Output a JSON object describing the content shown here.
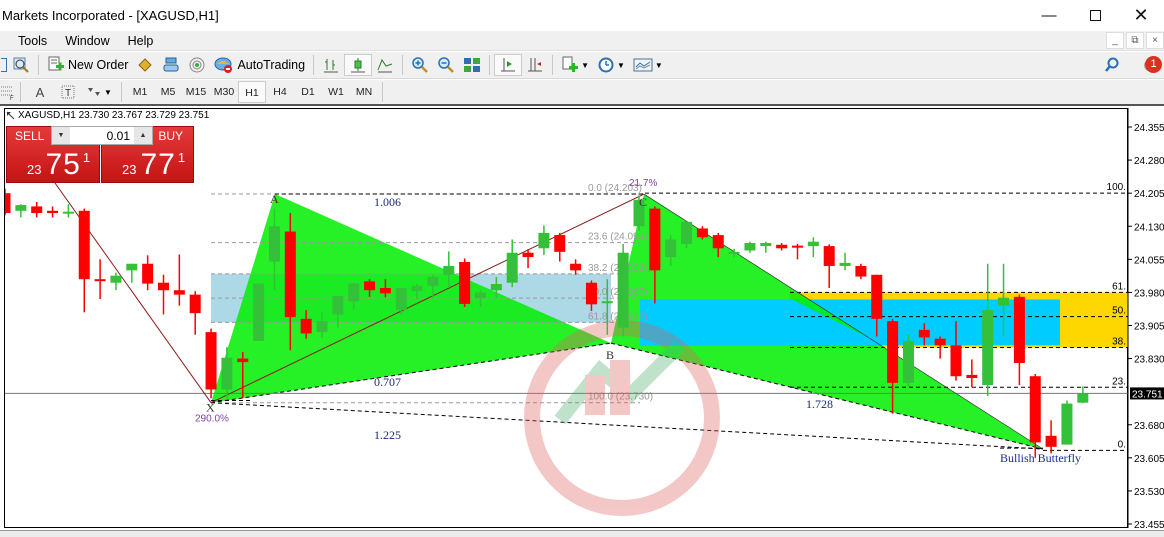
{
  "window": {
    "title": "Markets Incorporated - [XAGUSD,H1]",
    "controls": [
      "minimize",
      "maximize",
      "close"
    ]
  },
  "menu": {
    "items": [
      "Tools",
      "Window",
      "Help"
    ]
  },
  "toolbar": {
    "new_order_label": "New Order",
    "autotrading_label": "AutoTrading",
    "notification_count": "1"
  },
  "timeframes": {
    "items": [
      "M1",
      "M5",
      "M15",
      "M30",
      "H1",
      "H4",
      "D1",
      "W1",
      "MN"
    ],
    "active": "H1"
  },
  "chart": {
    "symbol_info": "XAGUSD,H1  23.730 23.767 23.729 23.751",
    "symbol": "XAGUSD",
    "timeframe": "H1",
    "ohlc": {
      "open": "23.730",
      "high": "23.767",
      "low": "23.729",
      "close": "23.751"
    },
    "current_price": "23.751",
    "price_axis": [
      "24.355",
      "24.280",
      "24.205",
      "24.130",
      "24.055",
      "23.980",
      "23.905",
      "23.830",
      "23.751",
      "23.680",
      "23.605",
      "23.530",
      "23.455"
    ]
  },
  "one_click_trading": {
    "sell_label": "SELL",
    "buy_label": "BUY",
    "lot": "0.01",
    "sell_price": {
      "prefix": "23",
      "main": "75",
      "sup": "1"
    },
    "buy_price": {
      "prefix": "23",
      "main": "77",
      "sup": "1"
    }
  },
  "pattern": {
    "name": "Bullish Butterfly",
    "points": {
      "X": "X",
      "A": "A",
      "B": "B",
      "C": "C",
      "D": ""
    },
    "ratios": {
      "XA_AB": "1.006",
      "AB": "0.707",
      "XD": "1.225",
      "BC_CD": "1.728"
    },
    "x_label": "290.0%",
    "c_label": "21.7%"
  },
  "fib_retracement": {
    "levels": [
      "0.0 (24.203)",
      "23.6 (24.093)",
      "38.2 (24.022)",
      "50.0 (23.967)",
      "61.8 (23.912)",
      "100.0 (23.730)"
    ]
  },
  "fib_right": {
    "levels": [
      "100.",
      "61.",
      "50.",
      "38.",
      "23.",
      "0."
    ]
  },
  "colors": {
    "bull": "#35c03a",
    "bear": "#ff0000",
    "pattern_fill": "#00ee00",
    "zone_blue": "#00ccff",
    "zone_lightblue": "#add8e6",
    "zone_yellow": "#ffd700",
    "sell_bg": "#d42020",
    "price_tag_bg": "#000000"
  },
  "candles": [
    {
      "o": 24.205,
      "h": 24.215,
      "l": 24.155,
      "c": 24.16
    },
    {
      "o": 24.165,
      "h": 24.18,
      "l": 24.15,
      "c": 24.178
    },
    {
      "o": 24.175,
      "h": 24.185,
      "l": 24.15,
      "c": 24.16
    },
    {
      "o": 24.165,
      "h": 24.175,
      "l": 24.15,
      "c": 24.16
    },
    {
      "o": 24.16,
      "h": 24.18,
      "l": 24.15,
      "c": 24.163
    },
    {
      "o": 24.165,
      "h": 24.17,
      "l": 23.935,
      "c": 24.01
    },
    {
      "o": 24.01,
      "h": 24.055,
      "l": 23.965,
      "c": 24.008
    },
    {
      "o": 24.002,
      "h": 24.025,
      "l": 23.985,
      "c": 24.018
    },
    {
      "o": 24.03,
      "h": 24.045,
      "l": 24.002,
      "c": 24.045
    },
    {
      "o": 24.045,
      "h": 24.064,
      "l": 23.985,
      "c": 24.0
    },
    {
      "o": 24.002,
      "h": 24.02,
      "l": 23.93,
      "c": 23.985
    },
    {
      "o": 23.985,
      "h": 24.066,
      "l": 23.95,
      "c": 23.975
    },
    {
      "o": 23.975,
      "h": 23.983,
      "l": 23.884,
      "c": 23.933
    },
    {
      "o": 23.89,
      "h": 23.898,
      "l": 23.74,
      "c": 23.76
    },
    {
      "o": 23.76,
      "h": 23.856,
      "l": 23.74,
      "c": 23.832
    },
    {
      "o": 23.83,
      "h": 23.845,
      "l": 23.74,
      "c": 23.822
    },
    {
      "o": 23.87,
      "h": 24.0,
      "l": 23.87,
      "c": 24.0
    },
    {
      "o": 24.05,
      "h": 24.17,
      "l": 23.985,
      "c": 24.13
    },
    {
      "o": 24.118,
      "h": 24.16,
      "l": 23.849,
      "c": 23.924
    },
    {
      "o": 23.92,
      "h": 23.94,
      "l": 23.875,
      "c": 23.887
    },
    {
      "o": 23.89,
      "h": 23.935,
      "l": 23.878,
      "c": 23.915
    },
    {
      "o": 23.93,
      "h": 23.96,
      "l": 23.9,
      "c": 23.972
    },
    {
      "o": 23.96,
      "h": 24.002,
      "l": 23.94,
      "c": 24.0
    },
    {
      "o": 24.005,
      "h": 24.01,
      "l": 23.97,
      "c": 23.985
    },
    {
      "o": 23.99,
      "h": 24.01,
      "l": 23.969,
      "c": 23.978
    },
    {
      "o": 23.94,
      "h": 23.99,
      "l": 23.93,
      "c": 23.99
    },
    {
      "o": 23.983,
      "h": 24.0,
      "l": 23.965,
      "c": 23.995
    },
    {
      "o": 23.995,
      "h": 24.02,
      "l": 23.968,
      "c": 24.015
    },
    {
      "o": 24.02,
      "h": 24.073,
      "l": 23.99,
      "c": 24.04
    },
    {
      "o": 24.049,
      "h": 24.057,
      "l": 23.947,
      "c": 23.954
    },
    {
      "o": 23.967,
      "h": 23.985,
      "l": 23.947,
      "c": 23.98
    },
    {
      "o": 23.985,
      "h": 24.015,
      "l": 23.968,
      "c": 23.999
    },
    {
      "o": 24.002,
      "h": 24.1,
      "l": 23.992,
      "c": 24.07
    },
    {
      "o": 24.07,
      "h": 24.078,
      "l": 24.035,
      "c": 24.06
    },
    {
      "o": 24.08,
      "h": 24.132,
      "l": 24.065,
      "c": 24.115
    },
    {
      "o": 24.11,
      "h": 24.115,
      "l": 24.05,
      "c": 24.072
    },
    {
      "o": 24.045,
      "h": 24.055,
      "l": 24.02,
      "c": 24.03
    },
    {
      "o": 24.002,
      "h": 24.007,
      "l": 23.938,
      "c": 23.953
    },
    {
      "o": 23.96,
      "h": 24.01,
      "l": 23.884,
      "c": 23.96
    },
    {
      "o": 23.9,
      "h": 24.09,
      "l": 23.88,
      "c": 24.07
    },
    {
      "o": 24.13,
      "h": 24.2,
      "l": 24.12,
      "c": 24.19
    },
    {
      "o": 24.17,
      "h": 24.175,
      "l": 23.955,
      "c": 24.03
    },
    {
      "o": 24.06,
      "h": 24.11,
      "l": 24.04,
      "c": 24.1
    },
    {
      "o": 24.09,
      "h": 24.14,
      "l": 24.08,
      "c": 24.14
    },
    {
      "o": 24.125,
      "h": 24.13,
      "l": 24.1,
      "c": 24.105
    },
    {
      "o": 24.11,
      "h": 24.115,
      "l": 24.06,
      "c": 24.08
    },
    {
      "o": 24.07,
      "h": 24.079,
      "l": 24.06,
      "c": 24.072
    },
    {
      "o": 24.075,
      "h": 24.095,
      "l": 24.07,
      "c": 24.092
    },
    {
      "o": 24.085,
      "h": 24.095,
      "l": 24.07,
      "c": 24.092
    },
    {
      "o": 24.088,
      "h": 24.092,
      "l": 24.075,
      "c": 24.08
    },
    {
      "o": 24.086,
      "h": 24.09,
      "l": 24.055,
      "c": 24.083
    },
    {
      "o": 24.085,
      "h": 24.105,
      "l": 24.06,
      "c": 24.095
    },
    {
      "o": 24.085,
      "h": 24.089,
      "l": 23.99,
      "c": 24.04
    },
    {
      "o": 24.04,
      "h": 24.07,
      "l": 24.03,
      "c": 24.047
    },
    {
      "o": 24.04,
      "h": 24.045,
      "l": 24.01,
      "c": 24.016
    },
    {
      "o": 24.02,
      "h": 24.02,
      "l": 23.88,
      "c": 23.92
    },
    {
      "o": 23.915,
      "h": 23.92,
      "l": 23.705,
      "c": 23.775
    },
    {
      "o": 23.775,
      "h": 23.885,
      "l": 23.765,
      "c": 23.87
    },
    {
      "o": 23.895,
      "h": 23.91,
      "l": 23.86,
      "c": 23.878
    },
    {
      "o": 23.875,
      "h": 23.88,
      "l": 23.83,
      "c": 23.86
    },
    {
      "o": 23.86,
      "h": 23.915,
      "l": 23.78,
      "c": 23.79
    },
    {
      "o": 23.793,
      "h": 23.828,
      "l": 23.765,
      "c": 23.786
    },
    {
      "o": 23.77,
      "h": 24.045,
      "l": 23.745,
      "c": 23.94
    },
    {
      "o": 23.95,
      "h": 24.045,
      "l": 23.88,
      "c": 23.968
    },
    {
      "o": 23.97,
      "h": 23.975,
      "l": 23.77,
      "c": 23.82
    },
    {
      "o": 23.79,
      "h": 23.795,
      "l": 23.605,
      "c": 23.64
    },
    {
      "o": 23.655,
      "h": 23.69,
      "l": 23.615,
      "c": 23.63
    },
    {
      "o": 23.635,
      "h": 23.735,
      "l": 23.635,
      "c": 23.728
    },
    {
      "o": 23.73,
      "h": 23.767,
      "l": 23.729,
      "c": 23.751
    }
  ]
}
